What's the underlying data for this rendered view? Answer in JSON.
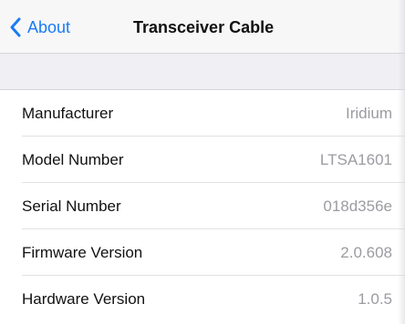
{
  "nav": {
    "back_label": "About",
    "title": "Transceiver Cable",
    "back_icon": "chevron-left-icon",
    "accent_color": "#1a7cf5"
  },
  "rows": [
    {
      "label": "Manufacturer",
      "value": "Iridium"
    },
    {
      "label": "Model Number",
      "value": "LTSA1601"
    },
    {
      "label": "Serial Number",
      "value": "018d356e"
    },
    {
      "label": "Firmware Version",
      "value": "2.0.608"
    },
    {
      "label": "Hardware Version",
      "value": "1.0.5"
    }
  ]
}
